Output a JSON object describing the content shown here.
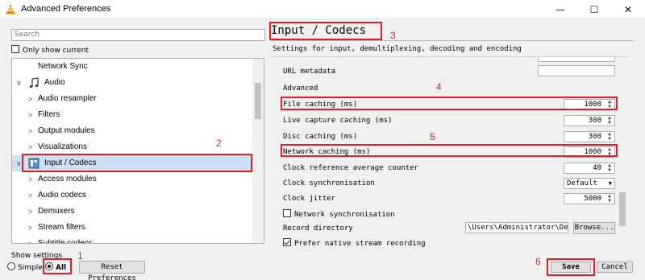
{
  "window": {
    "title": "Advanced Preferences",
    "controls": {
      "minimize": "—",
      "maximize": "☐",
      "close": "✕"
    }
  },
  "left": {
    "search_placeholder": "Search",
    "only_show_current": "Only show current",
    "tree": [
      {
        "label": "Network Sync",
        "arrow": "",
        "level": 1
      },
      {
        "label": "Audio",
        "arrow": "∨",
        "level": 0,
        "icon": "music-note-icon"
      },
      {
        "label": "Audio resampler",
        "arrow": ">",
        "level": 1
      },
      {
        "label": "Filters",
        "arrow": ">",
        "level": 1
      },
      {
        "label": "Output modules",
        "arrow": ">",
        "level": 1
      },
      {
        "label": "Visualizations",
        "arrow": ">",
        "level": 1
      },
      {
        "label": "Input / Codecs",
        "arrow": "∨",
        "level": 0,
        "icon": "codec-icon",
        "selected": true
      },
      {
        "label": "Access modules",
        "arrow": ">",
        "level": 1
      },
      {
        "label": "Audio codecs",
        "arrow": ">",
        "level": 1
      },
      {
        "label": "Demuxers",
        "arrow": ">",
        "level": 1
      },
      {
        "label": "Stream filters",
        "arrow": ">",
        "level": 1
      },
      {
        "label": "Subtitle codecs",
        "arrow": ">",
        "level": 1
      }
    ],
    "show_settings": "Show settings",
    "simple": "Simple",
    "all": "All",
    "reset": "Reset Preferences"
  },
  "right": {
    "title": "Input / Codecs",
    "subtitle": "Settings for input, demultiplexing, decoding and encoding",
    "url_metadata": "URL metadata",
    "advanced": "Advanced",
    "file_caching": {
      "label": "File caching (ms)",
      "value": "1000"
    },
    "live_capture": {
      "label": "Live capture caching (ms)",
      "value": "300"
    },
    "disc_caching": {
      "label": "Disc caching (ms)",
      "value": "300"
    },
    "network_caching": {
      "label": "Network caching (ms)",
      "value": "1000"
    },
    "clock_ref": {
      "label": "Clock reference average counter",
      "value": "40"
    },
    "clock_sync": {
      "label": "Clock synchronisation",
      "value": "Default"
    },
    "clock_jitter": {
      "label": "Clock jitter",
      "value": "5000"
    },
    "network_sync": "Network synchronisation",
    "record_dir": {
      "label": "Record directory",
      "value": "\\Users\\Administrator\\Desktop",
      "browse": "Browse..."
    },
    "prefer_native": "Prefer native stream recording"
  },
  "footer": {
    "save": "Save",
    "cancel": "Cancel"
  },
  "annotations": [
    "1",
    "2",
    "3",
    "4",
    "5",
    "6"
  ],
  "colors": {
    "annotation": "#e01e24",
    "selection": "#cde0f5"
  }
}
